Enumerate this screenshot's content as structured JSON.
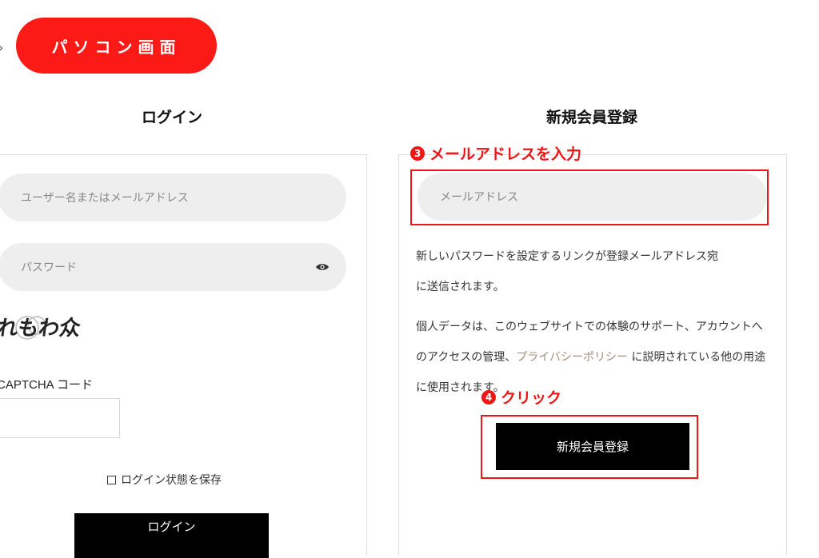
{
  "breadcrumb": {
    "chevron": "›"
  },
  "badge": {
    "label": "パソコン画面",
    "color": "#fb1a16"
  },
  "login": {
    "heading": "ログイン",
    "username_placeholder": "ユーザー名またはメールアドレス",
    "password_placeholder": "パスワード",
    "captcha_image_text": "れもわ众",
    "captcha_label": "CAPTCHA コード",
    "remember_label": "ログイン状態を保存",
    "submit_label": "ログイン"
  },
  "register": {
    "heading": "新規会員登録",
    "email_placeholder": "メールアドレス",
    "info_line1": "新しいパスワードを設定するリンクが登録メールアドレス宛",
    "info_line2": "に送信されます。",
    "privacy_pre": "個人データは、このウェブサイトでの体験のサポート、アカウントへのアクセスの管理、",
    "privacy_link": "プライバシーポリシー",
    "privacy_post": " に説明されている他の用途に使用されます。",
    "submit_label": "新規会員登録"
  },
  "annotations": {
    "step3_number": "3",
    "step3_text": "メールアドレスを入力",
    "step4_number": "4",
    "step4_text": "クリック",
    "color": "#f01616"
  }
}
